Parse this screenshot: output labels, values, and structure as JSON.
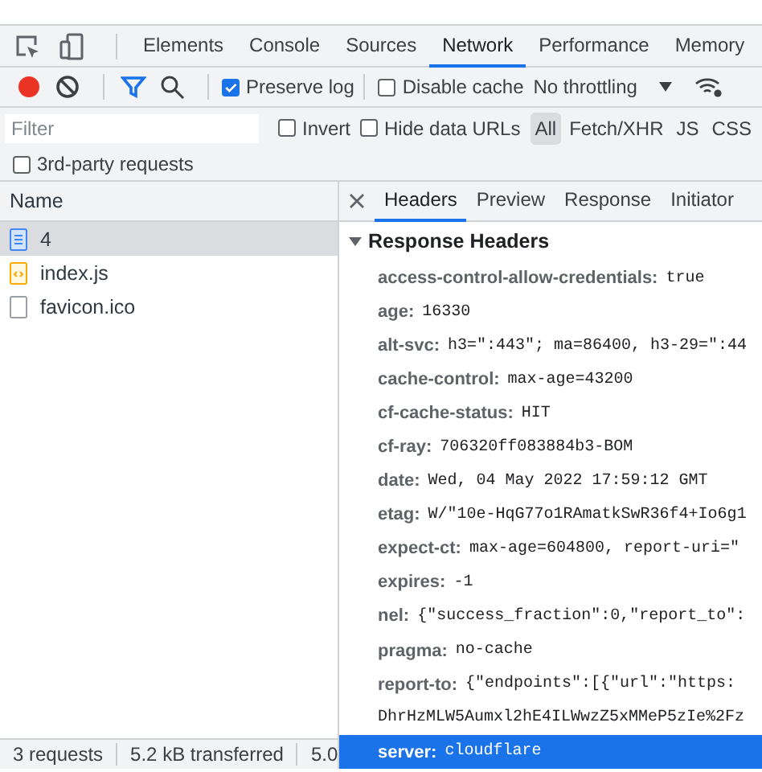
{
  "devtools_tabs": [
    {
      "label": "Elements",
      "selected": false
    },
    {
      "label": "Console",
      "selected": false
    },
    {
      "label": "Sources",
      "selected": false
    },
    {
      "label": "Network",
      "selected": true
    },
    {
      "label": "Performance",
      "selected": false
    },
    {
      "label": "Memory",
      "selected": false
    }
  ],
  "toolbar": {
    "preserve_log": {
      "label": "Preserve log",
      "checked": true
    },
    "disable_cache": {
      "label": "Disable cache",
      "checked": false
    },
    "throttling": "No throttling"
  },
  "filter": {
    "placeholder": "Filter",
    "invert": {
      "label": "Invert",
      "checked": false
    },
    "hide_data_urls": {
      "label": "Hide data URLs",
      "checked": false
    },
    "types": [
      {
        "label": "All",
        "selected": true
      },
      {
        "label": "Fetch/XHR",
        "selected": false
      },
      {
        "label": "JS",
        "selected": false
      },
      {
        "label": "CSS",
        "selected": false
      }
    ],
    "third_party": {
      "label": "3rd-party requests",
      "checked": false
    }
  },
  "requests": {
    "column": "Name",
    "rows": [
      {
        "name": "4",
        "kind": "document",
        "selected": true
      },
      {
        "name": "index.js",
        "kind": "script",
        "selected": false
      },
      {
        "name": "favicon.ico",
        "kind": "other",
        "selected": false
      }
    ]
  },
  "detail_tabs": [
    {
      "label": "Headers",
      "selected": true
    },
    {
      "label": "Preview",
      "selected": false
    },
    {
      "label": "Response",
      "selected": false
    },
    {
      "label": "Initiator",
      "selected": false
    }
  ],
  "response_headers": {
    "title": "Response Headers",
    "expanded": true,
    "headers": [
      {
        "name": "access-control-allow-credentials:",
        "value": "true",
        "selected": false
      },
      {
        "name": "age:",
        "value": "16330",
        "selected": false
      },
      {
        "name": "alt-svc:",
        "value": "h3=\":443\"; ma=86400, h3-29=\":44",
        "selected": false
      },
      {
        "name": "cache-control:",
        "value": "max-age=43200",
        "selected": false
      },
      {
        "name": "cf-cache-status:",
        "value": "HIT",
        "selected": false
      },
      {
        "name": "cf-ray:",
        "value": "706320ff083884b3-BOM",
        "selected": false
      },
      {
        "name": "date:",
        "value": "Wed, 04 May 2022 17:59:12 GMT",
        "selected": false
      },
      {
        "name": "etag:",
        "value": "W/\"10e-HqG77o1RAmatkSwR36f4+Io6g1",
        "selected": false
      },
      {
        "name": "expect-ct:",
        "value": "max-age=604800, report-uri=\"",
        "selected": false
      },
      {
        "name": "expires:",
        "value": "-1",
        "selected": false
      },
      {
        "name": "nel:",
        "value": "{\"success_fraction\":0,\"report_to\":",
        "selected": false
      },
      {
        "name": "pragma:",
        "value": "no-cache",
        "selected": false
      },
      {
        "name": "report-to:",
        "value": "{\"endpoints\":[{\"url\":\"https:",
        "continuation": "DhrHzMLW5Aumxl2hE4ILWwzZ5xMMeP5zIe%2Fz",
        "selected": false
      },
      {
        "name": "server:",
        "value": "cloudflare",
        "selected": true
      }
    ]
  },
  "status_bar": [
    "3 requests",
    "5.2 kB transferred",
    "5.0"
  ]
}
